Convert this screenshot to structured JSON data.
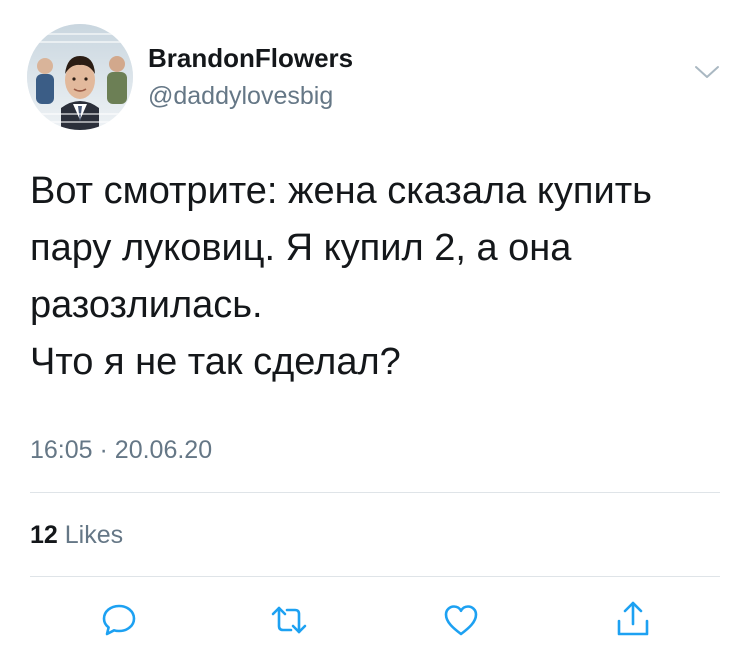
{
  "tweet": {
    "author": {
      "display_name": "BrandonFlowers",
      "handle": "@daddylovesbig",
      "avatar_icon": "avatar-photo"
    },
    "text_lines": [
      "Вот смотрите: жена сказала купить",
      "пару луковиц. Я купил 2, а она",
      "разозлилась.",
      "Что я не так сделал?"
    ],
    "time": "16:05",
    "separator": "·",
    "date": "20.06.20",
    "likes": {
      "count": "12",
      "label": "Likes"
    },
    "actions": {
      "reply_icon": "comment-icon",
      "retweet_icon": "retweet-icon",
      "like_icon": "heart-icon",
      "share_icon": "share-icon"
    },
    "colors": {
      "text": "#14171a",
      "secondary": "#657786",
      "icon": "#1da1f2",
      "divider": "#dfe4e8"
    }
  }
}
